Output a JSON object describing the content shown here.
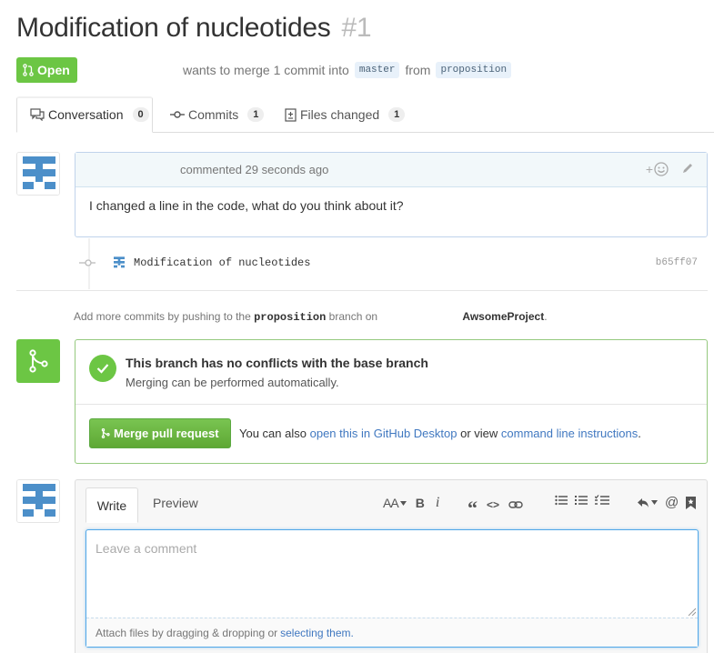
{
  "pr": {
    "title": "Modification of nucleotides",
    "number": "#1",
    "state": "Open",
    "meta_text": "wants to merge 1 commit into",
    "base_branch": "master",
    "from_text": "from",
    "head_branch": "proposition"
  },
  "tabs": [
    {
      "label": "Conversation",
      "count": "0"
    },
    {
      "label": "Commits",
      "count": "1"
    },
    {
      "label": "Files changed",
      "count": "1"
    }
  ],
  "comment": {
    "timestamp": "commented 29 seconds ago",
    "add_reaction": "+",
    "body": "I changed a line in the code, what do you think about it?"
  },
  "commit": {
    "message": "Modification of nucleotides",
    "sha": "b65ff07"
  },
  "push_note": {
    "prefix": "Add more commits by pushing to the",
    "branch": "proposition",
    "middle": "branch on",
    "repo": "AwsomeProject",
    "suffix": "."
  },
  "merge": {
    "title": "This branch has no conflicts with the base branch",
    "subtitle": "Merging can be performed automatically.",
    "button": "Merge pull request",
    "note_prefix": "You can also",
    "link_desktop": "open this in GitHub Desktop",
    "note_middle": "or view",
    "link_cli": "command line instructions",
    "note_suffix": "."
  },
  "composer": {
    "tab_write": "Write",
    "tab_preview": "Preview",
    "placeholder": "Leave a comment",
    "attach_prefix": "Attach files by dragging & dropping or",
    "attach_link": "selecting them.",
    "toolbar": {
      "heading": "AA",
      "bold": "B",
      "italic": "i",
      "quote": "“",
      "code": "<>",
      "mention": "@"
    }
  },
  "colors": {
    "green": "#6cc644",
    "link": "#4078c0",
    "identicon": "#4c8fc9"
  }
}
